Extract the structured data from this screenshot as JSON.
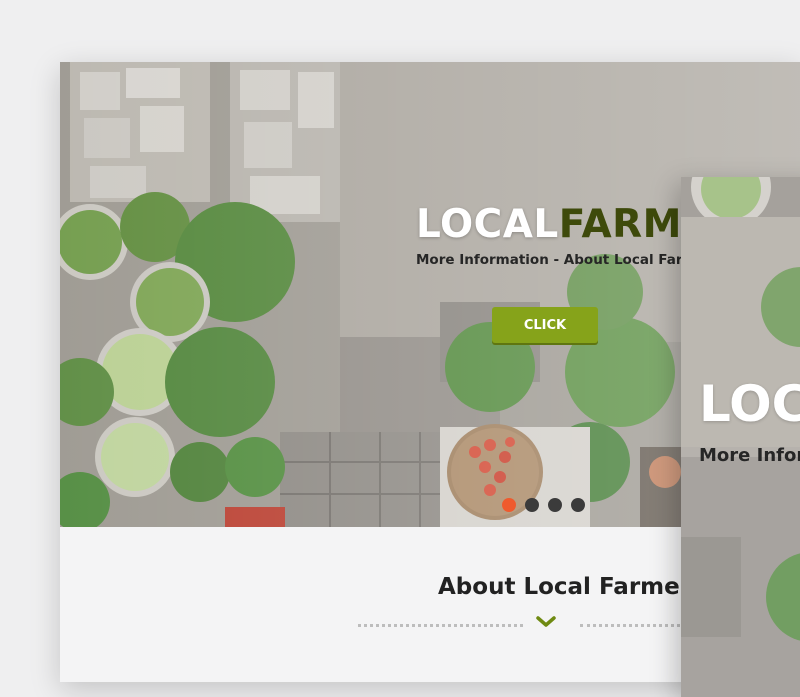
{
  "hero": {
    "title_part1": "LOCAL",
    "title_part2": "FARMER",
    "subtitle": "More Information - About Local Farmer",
    "cta_label": "CLICK",
    "slides": 4,
    "active_slide": 1
  },
  "about": {
    "heading": "About Local Farmer"
  },
  "second_card": {
    "title_visible": "LOC",
    "subtitle_visible": "More Infor"
  },
  "colors": {
    "accent_green": "#86a31a",
    "dark_olive": "#3e4a0b",
    "active_dot": "#ef5a2d",
    "inactive_dot": "#3b3b3b"
  },
  "icons": {
    "divider_chevron": "chevron-down-icon"
  }
}
